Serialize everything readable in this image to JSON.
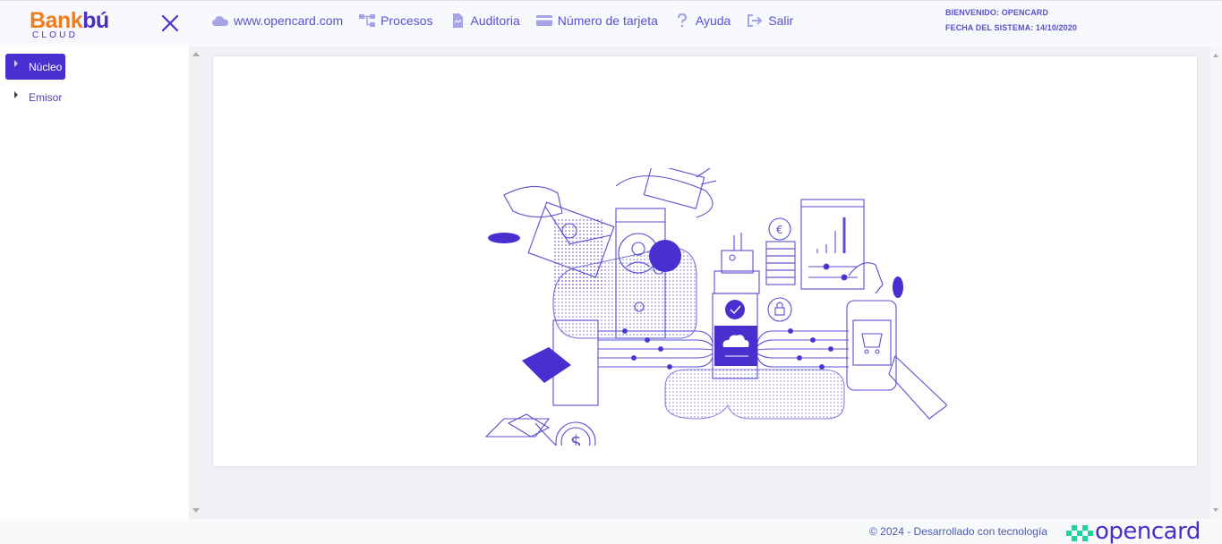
{
  "header": {
    "logo_word_1": "Bank",
    "logo_word_2": "bú",
    "logo_sub": "CLOUD",
    "nav": [
      {
        "label": "www.opencard.com",
        "icon": "cloud-icon"
      },
      {
        "label": "Procesos",
        "icon": "sitemap-icon"
      },
      {
        "label": "Auditoria",
        "icon": "document-icon"
      },
      {
        "label": "Número de tarjeta",
        "icon": "credit-card-icon"
      },
      {
        "label": "Ayuda",
        "icon": "question-icon"
      },
      {
        "label": "Salir",
        "icon": "logout-icon"
      }
    ],
    "welcome": "BIENVENIDO: OPENCARD",
    "system_date": "FECHA DEL SISTEMA: 14/10/2020"
  },
  "sidebar": {
    "items": [
      {
        "label": "Núcleo",
        "active": true
      },
      {
        "label": "Emisor",
        "active": false
      }
    ]
  },
  "footer": {
    "text": "© 2024 - Desarrollado con tecnología",
    "brand": "opencard"
  },
  "colors": {
    "accent": "#4a2fd0",
    "brand_orange": "#f07d1d",
    "brand_green": "#1fd3a0"
  }
}
